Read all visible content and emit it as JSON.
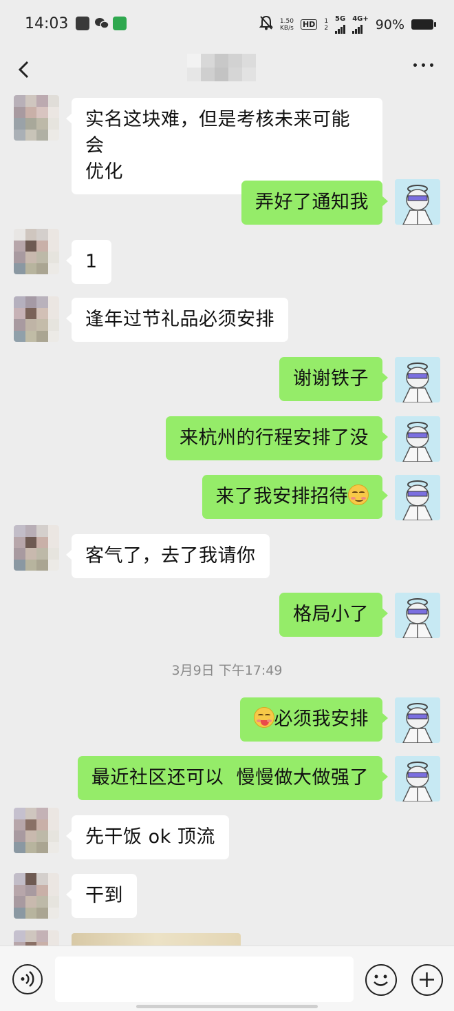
{
  "status_bar": {
    "time": "14:03",
    "speed_value": "1.50",
    "speed_unit": "KB/s",
    "hd": "HD",
    "sim1": "1",
    "sim2": "2",
    "net1": "5G",
    "net2": "4G+",
    "battery": "90%",
    "icons": [
      "notification-icon",
      "wechat-icon",
      "app-icon",
      "mute-bell-icon",
      "signal-icon",
      "battery-icon"
    ]
  },
  "header": {
    "contact_name_obscured": true,
    "back_icon": "chevron-left-icon",
    "more_icon": "more-dots-icon"
  },
  "messages": [
    {
      "side": "in",
      "text_lines": [
        "实名这块难，但是考核未来可能会",
        "优化"
      ]
    },
    {
      "side": "out",
      "text": "弄好了通知我"
    },
    {
      "side": "in",
      "text": "1"
    },
    {
      "side": "in",
      "text": "逢年过节礼品必须安排"
    },
    {
      "side": "out",
      "text": "谢谢铁子"
    },
    {
      "side": "out",
      "text": "来杭州的行程安排了没"
    },
    {
      "side": "out",
      "text": "来了我安排招待",
      "emoji_after": "blush-emoji"
    },
    {
      "side": "in",
      "text": "客气了，去了我请你"
    },
    {
      "side": "out",
      "text": "格局小了"
    },
    {
      "side": "out",
      "text": "必须我安排",
      "emoji_before": "tongue-emoji"
    },
    {
      "side": "out",
      "text": "最近社区还可以  慢慢做大做强了"
    },
    {
      "side": "in",
      "text": "先干饭 ok 顶流"
    },
    {
      "side": "in",
      "text": "干到"
    }
  ],
  "timestamp": "3月9日 下午17:49",
  "input_bar": {
    "voice_icon": "voice-icon",
    "emoji_icon": "emoji-icon",
    "plus_icon": "plus-icon",
    "placeholder": ""
  },
  "colors": {
    "background": "#ededed",
    "bubble_out": "#95ec69",
    "bubble_in": "#ffffff"
  }
}
